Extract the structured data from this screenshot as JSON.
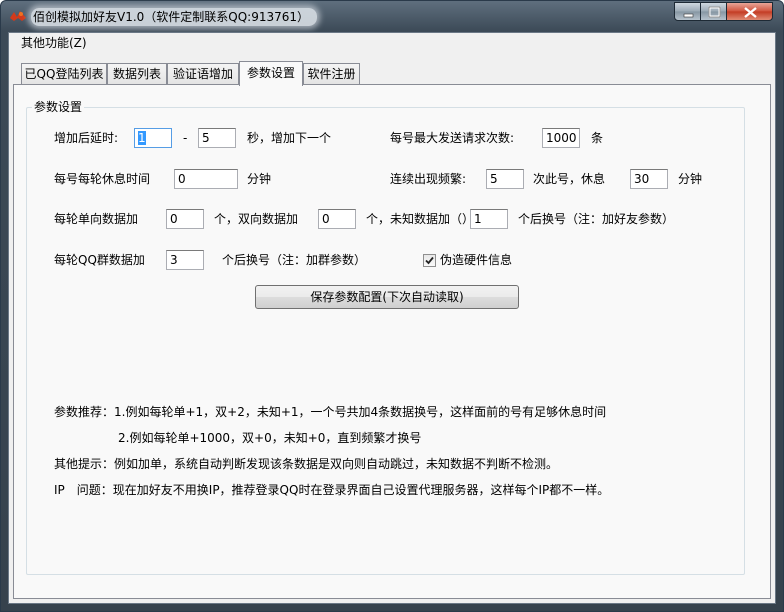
{
  "window": {
    "title": "佰创模拟加好友V1.0（软件定制联系QQ:913761）",
    "accent": "#3c4a57",
    "close_color": "#c23a22"
  },
  "menu": {
    "items": [
      "其他功能(Z)"
    ]
  },
  "tabs": [
    "已QQ登陆列表",
    "数据列表",
    "验证语增加",
    "参数设置",
    "软件注册"
  ],
  "active_tab": "参数设置",
  "group": {
    "title": "参数设置"
  },
  "settings": {
    "delay_label": "增加后延时:",
    "delay_min": "1",
    "delay_separator": "-",
    "delay_max": "5",
    "delay_suffix": "秒，增加下一个",
    "max_requests_label": "每号最大发送请求次数:",
    "max_requests_value": "1000",
    "max_requests_unit": "条",
    "rest_label": "每号每轮休息时间",
    "rest_value": "0",
    "rest_unit": "分钟",
    "freq_label": "连续出现频繁:",
    "freq_value": "5",
    "freq_suffix": "次此号，休息",
    "freq_rest_value": "30",
    "freq_rest_unit": "分钟",
    "oneway_label": "每轮单向数据加",
    "oneway_value": "0",
    "oneway_suffix": "个，双向数据加",
    "twoway_value": "0",
    "twoway_suffix": "个，未知数据加（）",
    "unknown_value": "1",
    "unknown_suffix": "个后换号（注：加好友参数）",
    "group_label": "每轮QQ群数据加",
    "group_value": "3",
    "group_suffix": "个后换号（注：加群参数）",
    "fake_hw_label": "伪造硬件信息",
    "fake_hw_checked": true,
    "save_button": "保存参数配置(下次自动读取)"
  },
  "notes": {
    "recommend_label": "参数推荐：",
    "recommend_1": "1.例如每轮单+1，双+2，未知+1，一个号共加4条数据换号，这样面前的号有足够休息时间",
    "recommend_2": "2.例如每轮单+1000，双+0，未知+0，直到频繁才换号",
    "other_tip": "其他提示：例如加单，系统自动判断发现该条数据是双向则自动跳过，未知数据不判断不检测。",
    "ip_question": "IP　问题：现在加好友不用换IP，推荐登录QQ时在登录界面自己设置代理服务器，这样每个IP都不一样。"
  },
  "icons": {
    "app": "app-logo-icon",
    "minimize": "minimize-icon",
    "maximize": "maximize-icon",
    "close": "close-icon",
    "check": "checkmark-icon"
  }
}
